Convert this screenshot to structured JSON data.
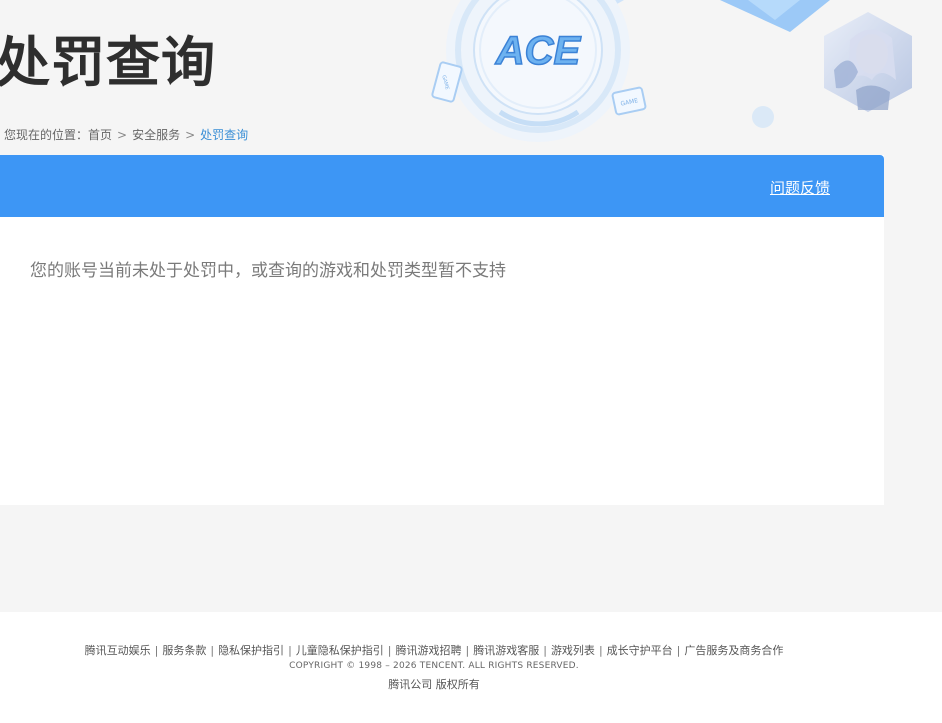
{
  "header": {
    "title": "处罚查询",
    "logo_text": "ACE",
    "game_badge_text": "GAME"
  },
  "breadcrumb": {
    "prefix": "您现在的位置：",
    "items": [
      "首页",
      "安全服务"
    ],
    "separator": ">",
    "current": "处罚查询"
  },
  "panel": {
    "feedback_label": "问题反馈",
    "result_message": "您的账号当前未处于处罚中，或查询的游戏和处罚类型暂不支持"
  },
  "footer": {
    "links": [
      "腾讯互动娱乐",
      "服务条款",
      "隐私保护指引",
      "儿童隐私保护指引",
      "腾讯游戏招聘",
      "腾讯游戏客服",
      "游戏列表",
      "成长守护平台",
      "广告服务及商务合作"
    ],
    "copyright": "COPYRIGHT © 1998 – 2026 TENCENT. ALL RIGHTS RESERVED.",
    "company": "腾讯公司 版权所有"
  },
  "colors": {
    "accent_blue": "#3d96f5",
    "breadcrumb_current": "#3a8fd6",
    "page_background": "#f5f5f5"
  }
}
